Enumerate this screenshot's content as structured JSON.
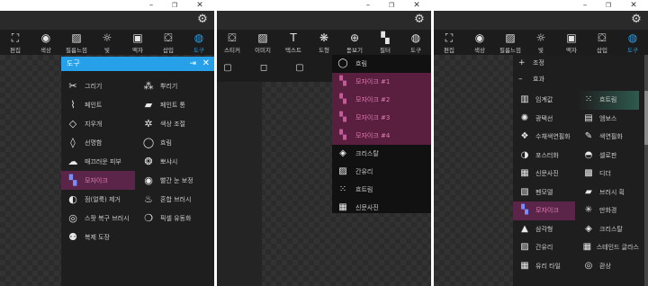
{
  "window_controls": {
    "minimize": "–",
    "maximize": "❐",
    "close": "✕"
  },
  "panel1": {
    "toolbar": [
      {
        "icon": "crop-icon",
        "glyph": "⛶",
        "label": "편집"
      },
      {
        "icon": "color-circle-icon",
        "glyph": "◉",
        "label": "색상"
      },
      {
        "icon": "photo-edit-icon",
        "glyph": "▨",
        "label": "필름느낌"
      },
      {
        "icon": "sun-icon",
        "glyph": "☼",
        "label": "빛"
      },
      {
        "icon": "frame-icon",
        "glyph": "▣",
        "label": "액자"
      },
      {
        "icon": "sticker-icon",
        "glyph": "⛋",
        "label": "삽입"
      },
      {
        "icon": "palette-icon",
        "glyph": "◍",
        "label": "도구"
      }
    ],
    "menu": {
      "title": "도구",
      "items": [
        [
          {
            "icon": "scissors-icon",
            "glyph": "✂",
            "label": "그리기"
          },
          {
            "icon": "spray-icon",
            "glyph": "⁂",
            "label": "뿌리기"
          }
        ],
        [
          {
            "icon": "brush-icon",
            "glyph": "⌇",
            "label": "페인트"
          },
          {
            "icon": "paint-bucket-pro-icon",
            "glyph": "▰",
            "label": "페인트 통"
          }
        ],
        [
          {
            "icon": "eraser-icon",
            "glyph": "◇",
            "label": "지우개"
          },
          {
            "icon": "color-adjust-icon",
            "glyph": "✲",
            "label": "색상 조절"
          }
        ],
        [
          {
            "icon": "lasso-icon",
            "glyph": "◊",
            "label": "선명함"
          },
          {
            "icon": "drop-icon",
            "glyph": "◯",
            "label": "흐림"
          }
        ],
        [
          {
            "icon": "skin-icon",
            "glyph": "☁",
            "label": "매끄러운 피부"
          },
          {
            "icon": "tint-icon",
            "glyph": "❂",
            "label": "뽀샤시"
          }
        ],
        [
          {
            "icon": "mosaic-icon",
            "glyph": "▚",
            "label": "모자이크"
          },
          {
            "icon": "eye-icon",
            "glyph": "◉",
            "label": "빨간 눈 보정"
          }
        ],
        [
          {
            "icon": "spot-remove-icon",
            "glyph": "◐",
            "label": "점(얼룩) 제거"
          },
          {
            "icon": "mixer-brush-icon",
            "glyph": "♨",
            "label": "혼합 브러시"
          }
        ],
        [
          {
            "icon": "stamp-icon",
            "glyph": "◎",
            "label": "스팟 복구 브러시"
          },
          {
            "icon": "pixel-liquify-icon",
            "glyph": "❍",
            "label": "픽셀 유동화"
          }
        ],
        [
          {
            "icon": "clone-stamp-pro-icon",
            "glyph": "⚉",
            "label": "복제 도장"
          }
        ]
      ]
    }
  },
  "panel2": {
    "toolbar": [
      {
        "icon": "sticker-icon",
        "glyph": "⛋",
        "label": "스티커"
      },
      {
        "icon": "image-icon",
        "glyph": "▨",
        "label": "이미지"
      },
      {
        "icon": "text-icon",
        "glyph": "T",
        "label": "텍스트"
      },
      {
        "icon": "shapes-icon",
        "glyph": "❋",
        "label": "도형"
      },
      {
        "icon": "magnifier-icon",
        "glyph": "⊕",
        "label": "돋보기"
      },
      {
        "icon": "filter-icon",
        "glyph": "▚",
        "label": "필터"
      },
      {
        "icon": "palette-icon",
        "glyph": "◍",
        "label": "도구"
      }
    ],
    "shapes": [
      "▢",
      "◻",
      "▢",
      "■"
    ],
    "menu": [
      {
        "icon": "drop-icon",
        "glyph": "◯",
        "label": "흐림"
      },
      {
        "icon": "mosaic-icon",
        "glyph": "▚",
        "label": "모자이크 #1"
      },
      {
        "icon": "mosaic-icon",
        "glyph": "▚",
        "label": "모자이크 #2"
      },
      {
        "icon": "mosaic-icon",
        "glyph": "▚",
        "label": "모자이크 #3"
      },
      {
        "icon": "mosaic-icon",
        "glyph": "▚",
        "label": "모자이크 #4"
      },
      {
        "icon": "crystal-icon",
        "glyph": "◈",
        "label": "크리스탈"
      },
      {
        "icon": "glass-icon",
        "glyph": "▨",
        "label": "간유리"
      },
      {
        "icon": "scatter-icon",
        "glyph": "⁙",
        "label": "흐트림"
      },
      {
        "icon": "newspaper-icon",
        "glyph": "▦",
        "label": "신문사진"
      }
    ]
  },
  "panel3": {
    "toolbar": [
      {
        "icon": "crop-icon",
        "glyph": "⛶",
        "label": "편집"
      },
      {
        "icon": "color-circle-icon",
        "glyph": "◉",
        "label": "색상"
      },
      {
        "icon": "photo-edit-icon",
        "glyph": "▨",
        "label": "필름느낌"
      },
      {
        "icon": "sun-icon",
        "glyph": "☼",
        "label": "빛"
      },
      {
        "icon": "frame-icon",
        "glyph": "▣",
        "label": "액자"
      },
      {
        "icon": "sticker-icon",
        "glyph": "⛋",
        "label": "삽입"
      },
      {
        "icon": "palette-icon",
        "glyph": "◍",
        "label": "도구"
      }
    ],
    "sections": [
      {
        "sign": "+",
        "label": "조정"
      },
      {
        "sign": "–",
        "label": "효과"
      }
    ],
    "effects": [
      [
        {
          "icon": "threshold-icon",
          "glyph": "▥",
          "label": "임계값"
        },
        {
          "icon": "scatter-icon",
          "glyph": "⁙",
          "label": "흐트림"
        }
      ],
      [
        {
          "icon": "glow-icon",
          "glyph": "✺",
          "label": "광택선"
        },
        {
          "icon": "emboss-icon",
          "glyph": "▤",
          "label": "엠보스"
        }
      ],
      [
        {
          "icon": "watercolor-icon",
          "glyph": "❖",
          "label": "수채색연필화"
        },
        {
          "icon": "pencil-color-icon",
          "glyph": "✎",
          "label": "색연필화"
        }
      ],
      [
        {
          "icon": "poster-icon",
          "glyph": "◑",
          "label": "포스터화"
        },
        {
          "icon": "cellophane-icon",
          "glyph": "◓",
          "label": "셀로판"
        }
      ],
      [
        {
          "icon": "newspaper-icon",
          "glyph": "▦",
          "label": "신문사진"
        },
        {
          "icon": "dither-icon",
          "glyph": "▩",
          "label": "디더"
        }
      ],
      [
        {
          "icon": "pen-sketch-icon",
          "glyph": "▧",
          "label": "펜모델"
        },
        {
          "icon": "brush-stroke-icon",
          "glyph": "▰",
          "label": "브러시 획"
        }
      ],
      [
        {
          "icon": "mosaic-icon",
          "glyph": "▚",
          "label": "모자이크"
        },
        {
          "icon": "kaleidoscope-icon",
          "glyph": "✳",
          "label": "만화경"
        }
      ],
      [
        {
          "icon": "triangle-icon",
          "glyph": "▲",
          "label": "삼각형"
        },
        {
          "icon": "crystal-icon",
          "glyph": "◈",
          "label": "크리스탈"
        }
      ],
      [
        {
          "icon": "glass-icon",
          "glyph": "▨",
          "label": "간유리"
        },
        {
          "icon": "stained-glass-icon",
          "glyph": "▦",
          "label": "스테인드 글라스"
        }
      ],
      [
        {
          "icon": "glass-tile-icon",
          "glyph": "▦",
          "label": "유리 타일"
        },
        {
          "icon": "illusion-icon",
          "glyph": "◎",
          "label": "환상"
        }
      ]
    ]
  }
}
